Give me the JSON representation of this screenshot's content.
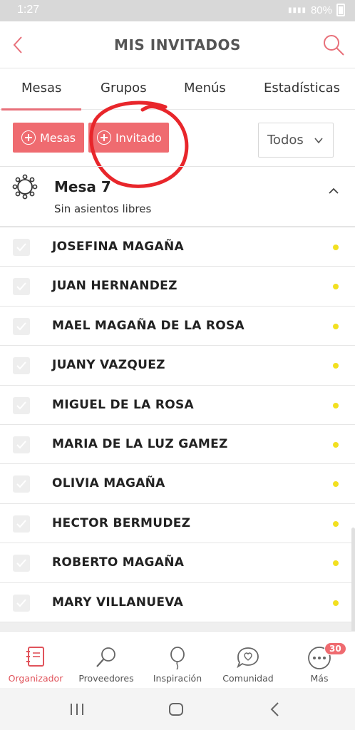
{
  "status_bar": {
    "time": "1:27",
    "battery": "80%"
  },
  "header": {
    "title": "MIS INVITADOS",
    "back_icon": "chevron-left-icon",
    "search_icon": "search-icon"
  },
  "tabs": [
    {
      "label": "Mesas",
      "active": true
    },
    {
      "label": "Grupos",
      "active": false
    },
    {
      "label": "Menús",
      "active": false
    },
    {
      "label": "Estadísticas",
      "active": false
    }
  ],
  "actions": {
    "add_table_label": "Mesas",
    "add_guest_label": "Invitado",
    "filter": {
      "selected": "Todos"
    }
  },
  "table": {
    "title": "Mesa 7",
    "subtitle": "Sin asientos libres",
    "guests": [
      {
        "name": "JOSEFINA MAGAÑA"
      },
      {
        "name": "JUAN HERNANDEZ"
      },
      {
        "name": "MAEL MAGAÑA DE LA ROSA"
      },
      {
        "name": "JUANY VAZQUEZ"
      },
      {
        "name": "MIGUEL DE LA ROSA"
      },
      {
        "name": "MARIA DE LA LUZ GAMEZ"
      },
      {
        "name": "OLIVIA MAGAÑA"
      },
      {
        "name": "HECTOR BERMUDEZ"
      },
      {
        "name": "ROBERTO MAGAÑA"
      },
      {
        "name": "MARY VILLANUEVA"
      }
    ]
  },
  "bottom_nav": {
    "items": [
      {
        "label": "Organizador",
        "icon": "planner-icon",
        "active": true
      },
      {
        "label": "Proveedores",
        "icon": "magnifier-icon",
        "active": false
      },
      {
        "label": "Inspiración",
        "icon": "balloon-icon",
        "active": false
      },
      {
        "label": "Comunidad",
        "icon": "chat-heart-icon",
        "active": false
      },
      {
        "label": "Más",
        "icon": "more-icon",
        "active": false,
        "badge": "30"
      }
    ]
  },
  "colors": {
    "accent": "#ef6b70",
    "status_dot": "#f2e020",
    "annotation": "#e8262b"
  }
}
